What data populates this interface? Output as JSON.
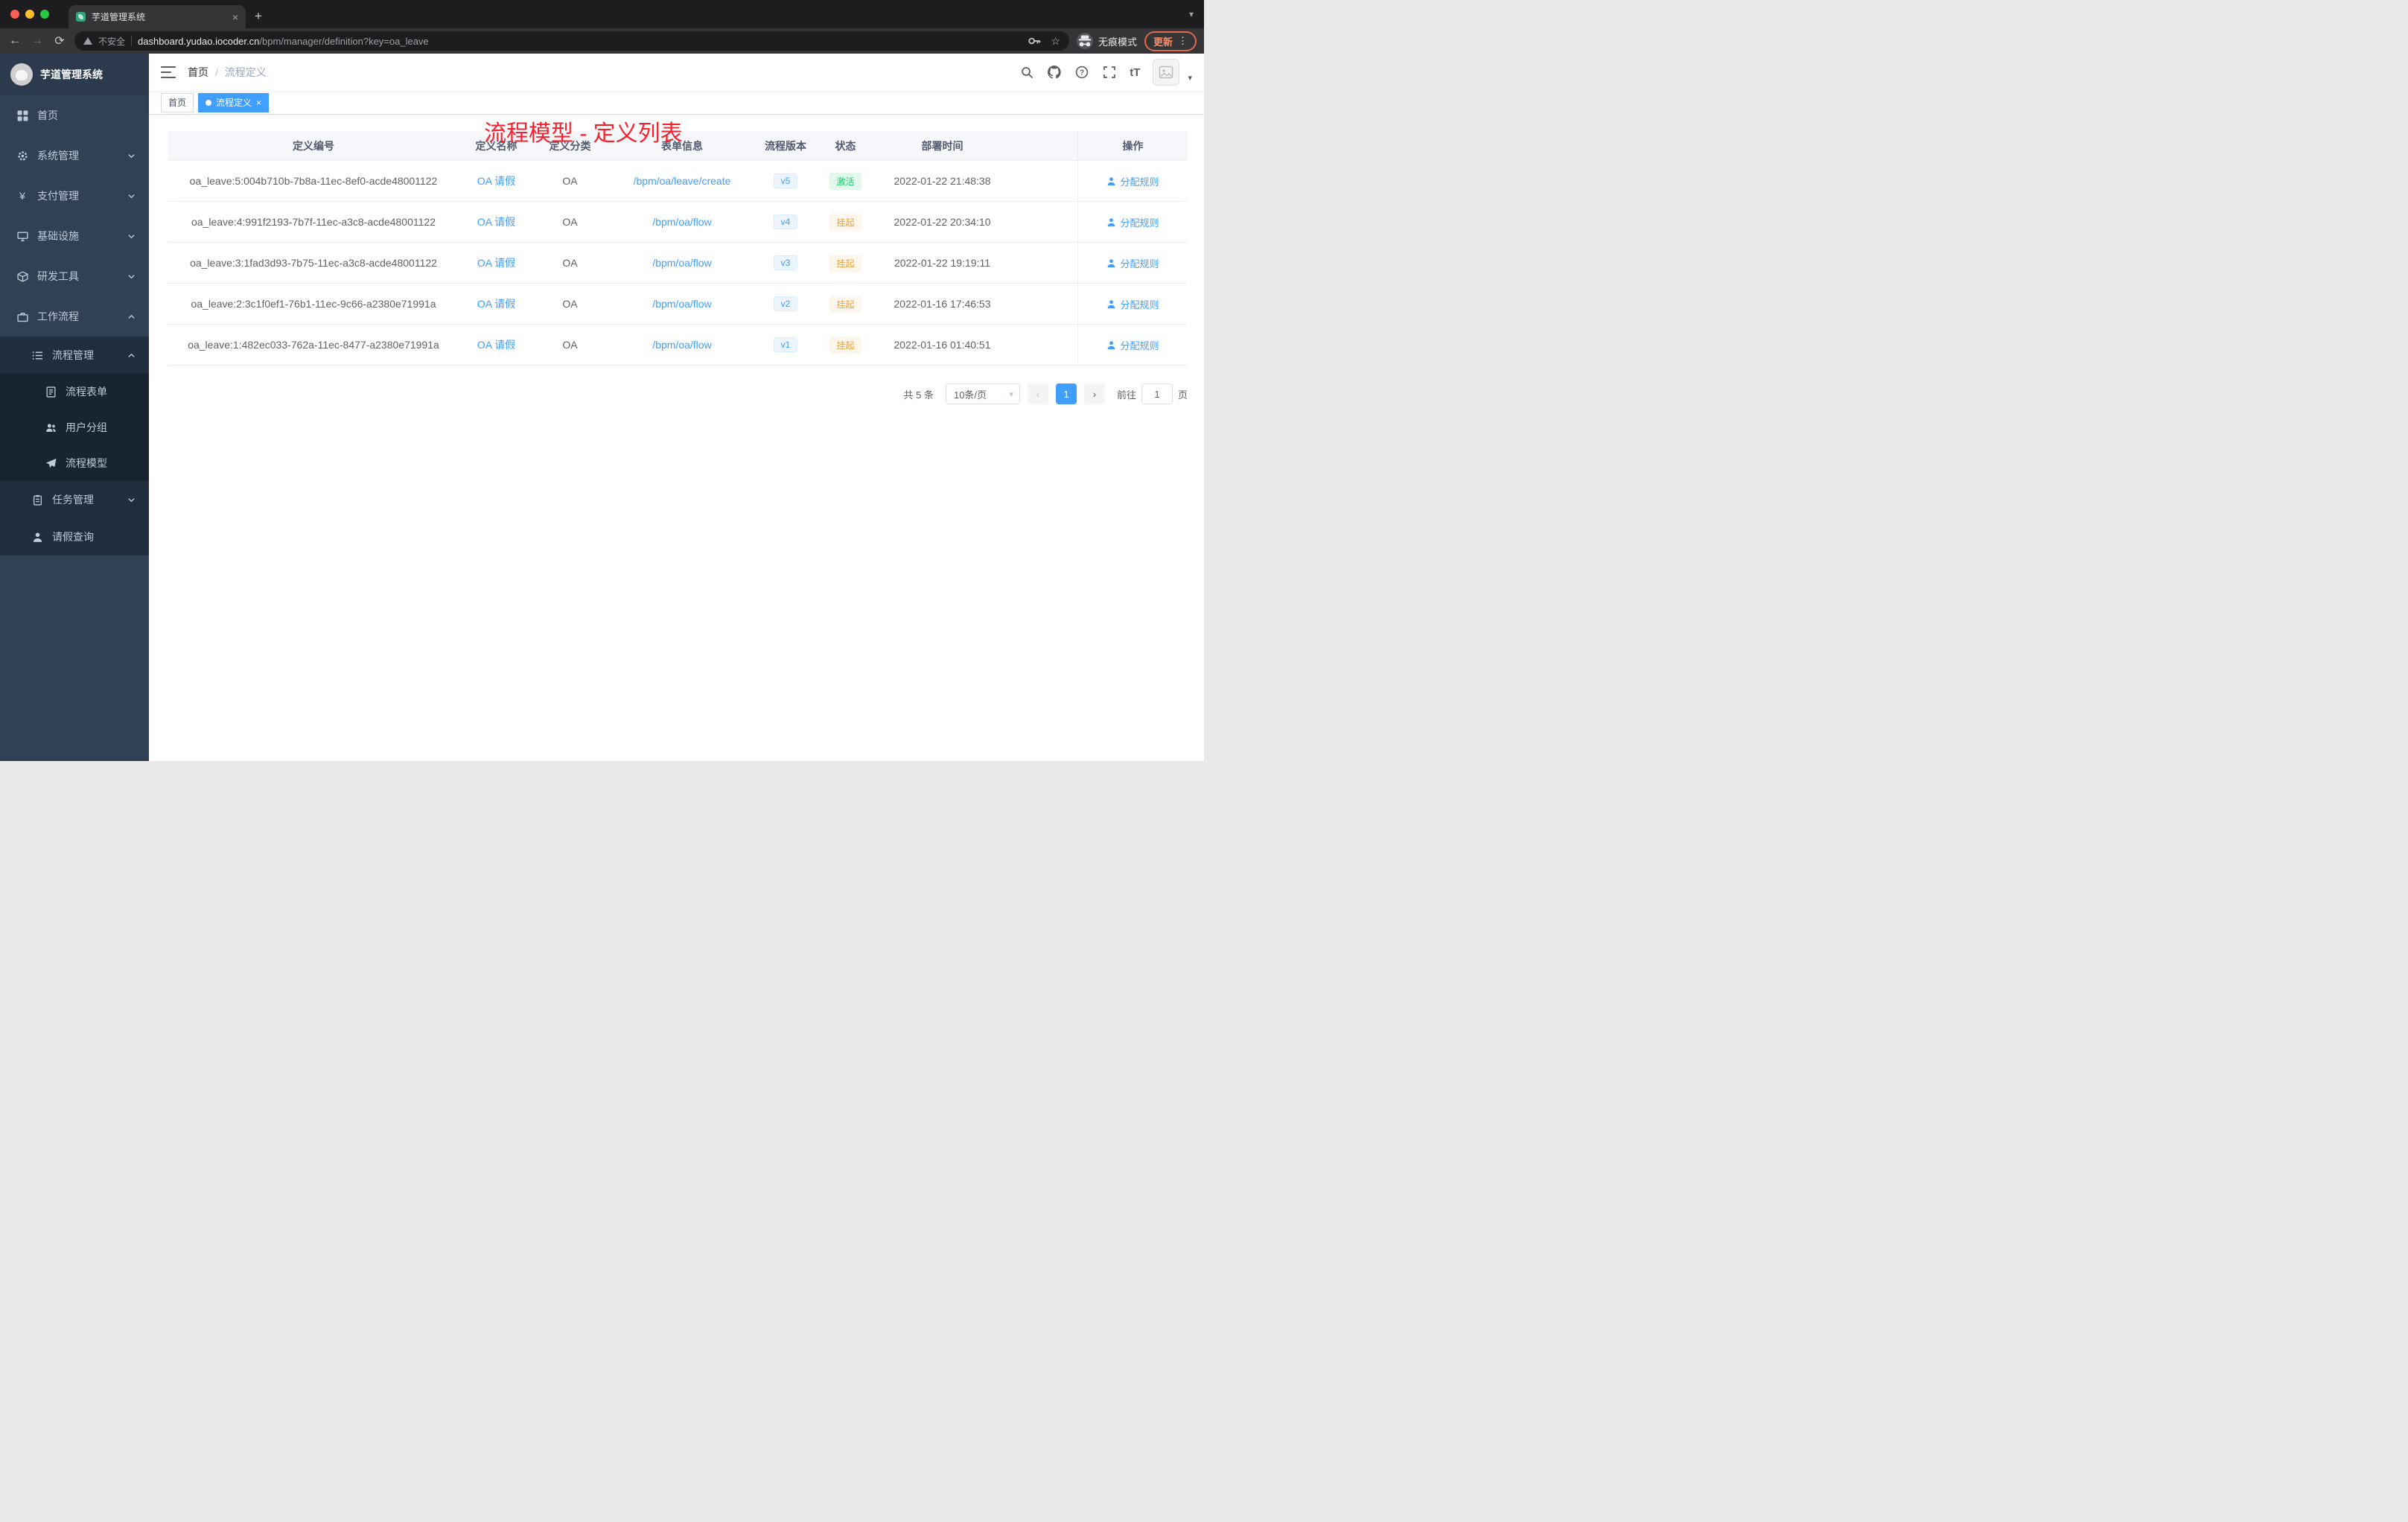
{
  "colors": {
    "accent": "#409eff",
    "annotation_red": "#f5222d",
    "sidebar_bg": "#304156",
    "submenu_bg": "#1f2d3d"
  },
  "icons": {
    "close": "×",
    "plus": "+",
    "back": "←",
    "forward": "→",
    "reload": "⟳",
    "star": "☆",
    "dots": "⋮",
    "caret_down": "▾",
    "prev": "‹",
    "next": "›",
    "yen": "¥",
    "font_size": "tT",
    "question": "?"
  },
  "browser": {
    "tab_title": "芋道管理系统",
    "address": {
      "security_label": "不安全",
      "host": "dashboard.yudao.iocoder.cn",
      "path": "/bpm/manager/definition?key=oa_leave"
    },
    "incognito_label": "无痕模式",
    "update_label": "更新"
  },
  "sidebar": {
    "logo_title": "芋道管理系统",
    "items": [
      {
        "label": "首页"
      },
      {
        "label": "系统管理"
      },
      {
        "label": "支付管理"
      },
      {
        "label": "基础设施"
      },
      {
        "label": "研发工具"
      },
      {
        "label": "工作流程"
      },
      {
        "label": "流程管理"
      },
      {
        "label": "流程表单"
      },
      {
        "label": "用户分组"
      },
      {
        "label": "流程模型"
      },
      {
        "label": "任务管理"
      },
      {
        "label": "请假查询"
      }
    ]
  },
  "navbar": {
    "breadcrumb": {
      "home": "首页",
      "separator": "/",
      "current": "流程定义"
    }
  },
  "annotation": "流程模型 - 定义列表",
  "tags": {
    "home": "首页",
    "current": "流程定义"
  },
  "table": {
    "columns": {
      "id": "定义编号",
      "name": "定义名称",
      "category": "定义分类",
      "form": "表单信息",
      "version": "流程版本",
      "status": "状态",
      "deploy_time": "部署时间",
      "actions": "操作"
    },
    "action_label": "分配规则",
    "rows": [
      {
        "id": "oa_leave:5:004b710b-7b8a-11ec-8ef0-acde48001122",
        "name": "OA 请假",
        "category": "OA",
        "form": "/bpm/oa/leave/create",
        "version": "v5",
        "status": "激活",
        "time": "2022-01-22 21:48:38"
      },
      {
        "id": "oa_leave:4:991f2193-7b7f-11ec-a3c8-acde48001122",
        "name": "OA 请假",
        "category": "OA",
        "form": "/bpm/oa/flow",
        "version": "v4",
        "status": "挂起",
        "time": "2022-01-22 20:34:10"
      },
      {
        "id": "oa_leave:3:1fad3d93-7b75-11ec-a3c8-acde48001122",
        "name": "OA 请假",
        "category": "OA",
        "form": "/bpm/oa/flow",
        "version": "v3",
        "status": "挂起",
        "time": "2022-01-22 19:19:11"
      },
      {
        "id": "oa_leave:2:3c1f0ef1-76b1-11ec-9c66-a2380e71991a",
        "name": "OA 请假",
        "category": "OA",
        "form": "/bpm/oa/flow",
        "version": "v2",
        "status": "挂起",
        "time": "2022-01-16 17:46:53"
      },
      {
        "id": "oa_leave:1:482ec033-762a-11ec-8477-a2380e71991a",
        "name": "OA 请假",
        "category": "OA",
        "form": "/bpm/oa/flow",
        "version": "v1",
        "status": "挂起",
        "time": "2022-01-16 01:40:51"
      }
    ]
  },
  "pagination": {
    "total": "共 5 条",
    "page_size": "10条/页",
    "current_page": "1",
    "goto_label": "前往",
    "goto_value": "1",
    "page_unit": "页"
  }
}
